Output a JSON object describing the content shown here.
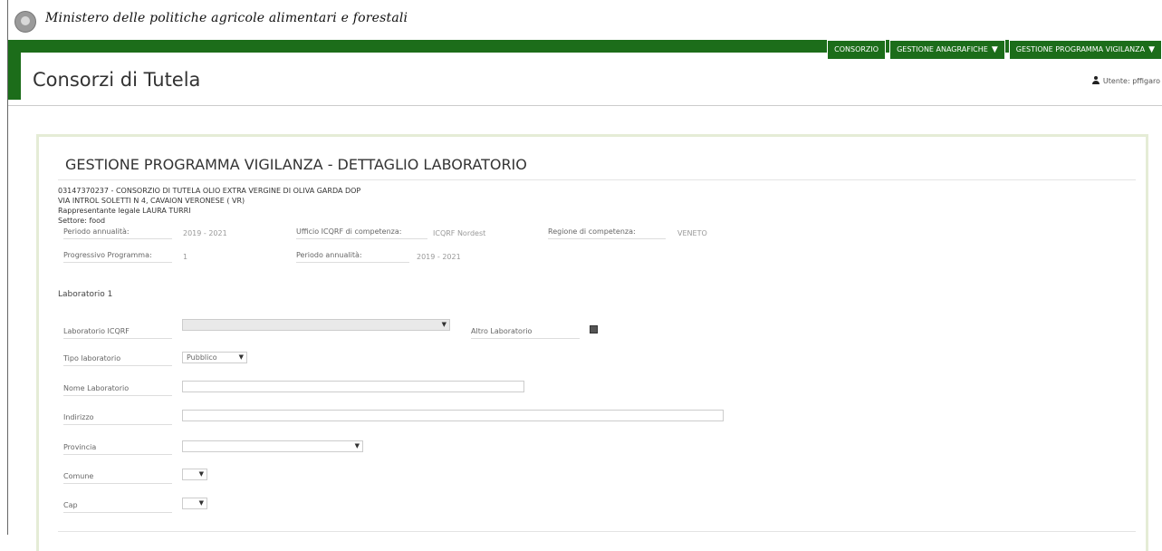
{
  "header": {
    "ministry_name": "Ministero delle politiche agricole alimentari e forestali",
    "app_title": "Consorzi di Tutela",
    "user_label": "Utente: pffigaro"
  },
  "menu": {
    "items": [
      {
        "label": "CONSORZIO",
        "has_caret": false
      },
      {
        "label": "GESTIONE ANAGRAFICHE",
        "has_caret": true
      },
      {
        "label": "GESTIONE PROGRAMMA VIGILANZA",
        "has_caret": true
      }
    ],
    "caret": "▼"
  },
  "page": {
    "title": "GESTIONE PROGRAMMA VIGILANZA - DETTAGLIO LABORATORIO",
    "consortium_line": "03147370237 - CONSORZIO DI TUTELA OLIO EXTRA VERGINE DI OLIVA GARDA DOP",
    "address_line": "VIA INTROL SOLETTI N 4, CAVAION VERONESE ( VR)",
    "legal_rep_line": "Rappresentante legale LAURA TURRI",
    "sector_line": "Settore: food"
  },
  "summary": {
    "periodo_label": "Periodo annualità:",
    "periodo_value": "2019 - 2021",
    "ufficio_label": "Ufficio ICQRF di competenza:",
    "ufficio_value": "ICQRF Nordest",
    "regione_label": "Regione di competenza:",
    "regione_value": "VENETO",
    "progressivo_label": "Progressivo Programma:",
    "progressivo_value": "1",
    "periodo2_label": "Periodo annualità:",
    "periodo2_value": "2019 - 2021"
  },
  "laboratory": {
    "section_title": "Laboratorio 1",
    "lab_icqrf_label": "Laboratorio ICQRF",
    "lab_icqrf_value": "",
    "altro_label": "Altro Laboratorio",
    "altro_checked": true,
    "tipo_label": "Tipo laboratorio",
    "tipo_value": "Pubblico",
    "nome_label": "Nome Laboratorio",
    "nome_value": "",
    "indirizzo_label": "Indirizzo",
    "indirizzo_value": "",
    "provincia_label": "Provincia",
    "provincia_value": "",
    "comune_label": "Comune",
    "comune_value": "",
    "cap_label": "Cap",
    "cap_value": ""
  },
  "colors": {
    "primary_green": "#1c6d1a",
    "panel_border": "#e5ecd6"
  },
  "icons": {
    "user": "user-icon",
    "emblem": "republic-emblem-icon",
    "dropdown": "dropdown-arrow-icon",
    "checkbox": "checkbox-icon"
  }
}
